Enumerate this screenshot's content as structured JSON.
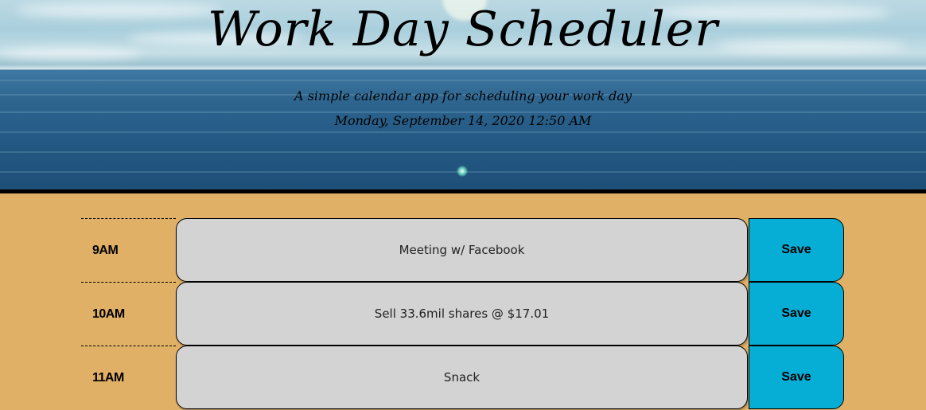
{
  "header": {
    "title": "Work Day Scheduler",
    "subtitle": "A simple calendar app for scheduling your work day",
    "current_day": "Monday, September 14, 2020 12:50 AM"
  },
  "time_blocks": [
    {
      "hour": "9AM",
      "description": "Meeting w/ Facebook",
      "save_label": "Save"
    },
    {
      "hour": "10AM",
      "description": "Sell 33.6mil shares @ $17.01",
      "save_label": "Save"
    },
    {
      "hour": "11AM",
      "description": "Snack",
      "save_label": "Save"
    }
  ],
  "colors": {
    "page_background": "#e0b066",
    "description_background": "#d3d3d3",
    "save_button": "#06aed5"
  }
}
